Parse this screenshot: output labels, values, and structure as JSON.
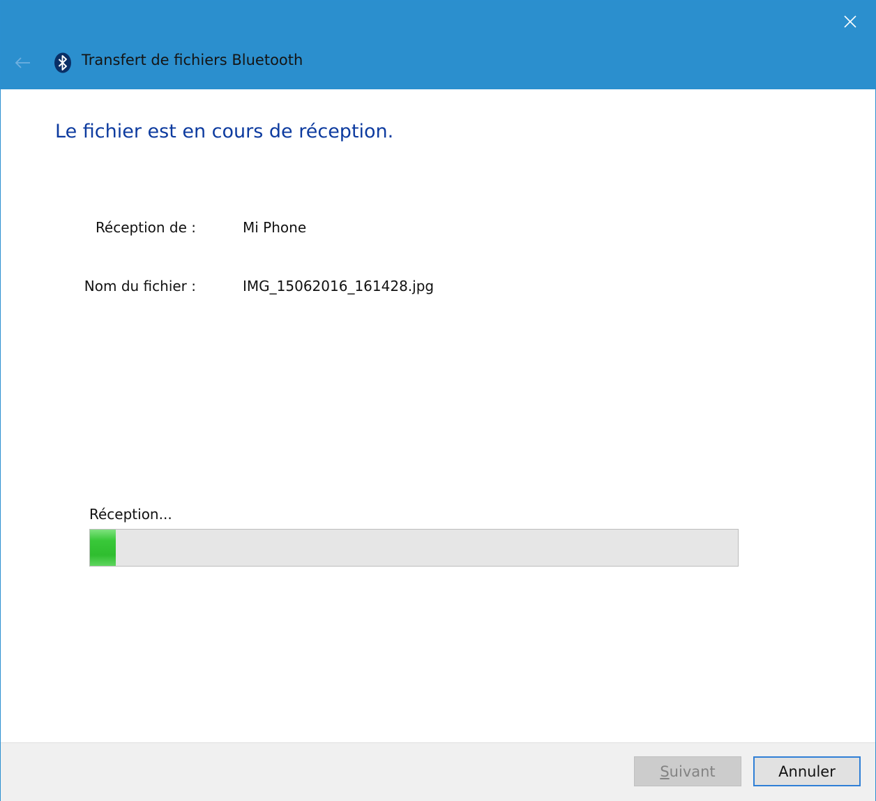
{
  "window": {
    "title": "Transfert de fichiers Bluetooth",
    "accent_color": "#2b8fce",
    "icons": {
      "back": "back-arrow-icon",
      "app": "bluetooth-icon",
      "close": "close-icon"
    }
  },
  "heading": "Le fichier est en cours de réception.",
  "details": [
    {
      "label": "Réception de :",
      "value": "Mi Phone"
    },
    {
      "label": "Nom du fichier :",
      "value": "IMG_15062016_161428.jpg"
    }
  ],
  "progress": {
    "label": "Réception...",
    "percent": 4,
    "fill_color": "#39c839"
  },
  "buttons": {
    "next": {
      "label_mnemonic": "S",
      "label_rest": "uivant",
      "enabled": false
    },
    "cancel": {
      "label": "Annuler",
      "enabled": true
    }
  }
}
